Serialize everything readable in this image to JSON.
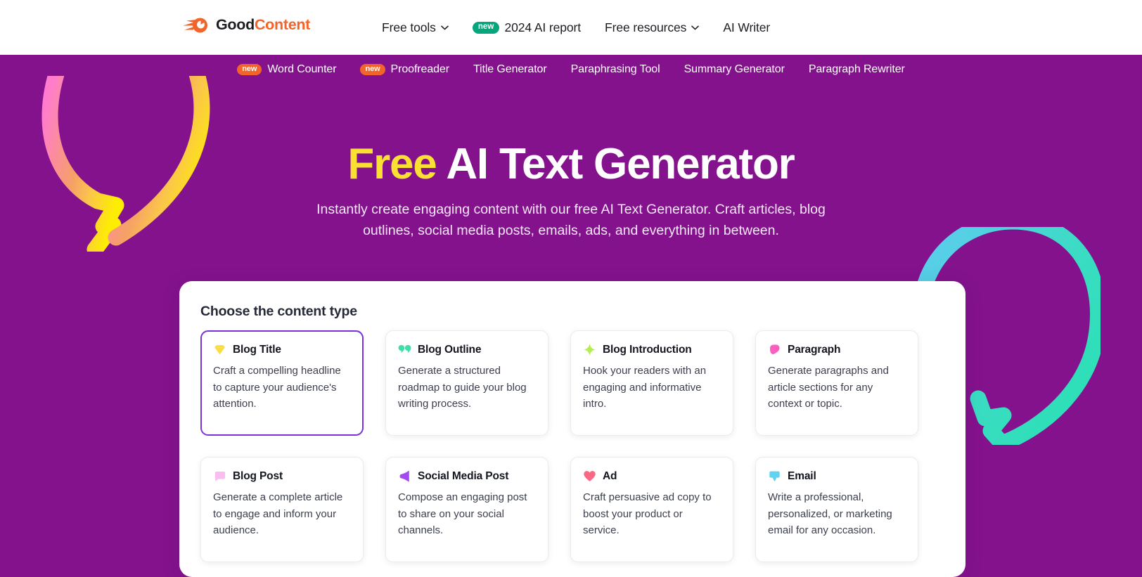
{
  "header": {
    "logo": {
      "icon": "comet-icon",
      "text_primary": "Good",
      "text_accent": "Content"
    },
    "nav": [
      {
        "label": "Free tools",
        "icon": "chevron-down-icon",
        "badge": null
      },
      {
        "label": "2024 AI report",
        "icon": null,
        "badge": "new"
      },
      {
        "label": "Free resources",
        "icon": "chevron-down-icon",
        "badge": null
      },
      {
        "label": "AI Writer",
        "icon": null,
        "badge": null
      }
    ]
  },
  "subnav": {
    "items": [
      {
        "label": "Word Counter",
        "badge": "new"
      },
      {
        "label": "Proofreader",
        "badge": "new"
      },
      {
        "label": "Title Generator",
        "badge": null
      },
      {
        "label": "Paraphrasing Tool",
        "badge": null
      },
      {
        "label": "Summary Generator",
        "badge": null
      },
      {
        "label": "Paragraph Rewriter",
        "badge": null
      }
    ]
  },
  "hero": {
    "title_highlight": "Free",
    "title_rest": " AI Text Generator",
    "subtitle": "Instantly create engaging content with our free AI Text Generator. Craft articles, blog outlines, social media posts, emails, ads, and everything in between."
  },
  "panel": {
    "title": "Choose the content type",
    "cards": [
      {
        "title": "Blog Title",
        "description": "Craft a compelling headline to capture your audience's attention.",
        "icon": "diamond-icon",
        "icon_color": "#fbdd3d",
        "selected": true
      },
      {
        "title": "Blog Outline",
        "description": "Generate a structured roadmap to guide your blog writing process.",
        "icon": "double-bubble-icon",
        "icon_color": "#3edfa6",
        "selected": false
      },
      {
        "title": "Blog Introduction",
        "description": "Hook your readers with an engaging and informative intro.",
        "icon": "sparkle-icon",
        "icon_color": "#b5ed55",
        "selected": false
      },
      {
        "title": "Paragraph",
        "description": "Generate paragraphs and article sections for any context or topic.",
        "icon": "pink-blob-icon",
        "icon_color": "#fd5fc0",
        "selected": false
      },
      {
        "title": "Blog Post",
        "description": "Generate a complete article to engage and inform your audience.",
        "icon": "chat-bubble-icon",
        "icon_color": "#f9bdf0",
        "selected": false
      },
      {
        "title": "Social Media Post",
        "description": "Compose an engaging post to share on your social channels.",
        "icon": "megaphone-icon",
        "icon_color": "#a24bf0",
        "selected": false
      },
      {
        "title": "Ad",
        "description": "Craft persuasive ad copy to boost your product or service.",
        "icon": "heart-icon",
        "icon_color": "#fb6883",
        "selected": false
      },
      {
        "title": "Email",
        "description": "Write a professional, personalized, or marketing email for any occasion.",
        "icon": "envelope-icon",
        "icon_color": "#5fd3ef",
        "selected": false
      }
    ]
  },
  "decor": {
    "left_bubble": {
      "name": "speech-bubble-gradient-left",
      "from": "#ff7ccd",
      "mid": "#f8a263",
      "to": "#fdee00"
    },
    "right_bubble": {
      "name": "speech-bubble-gradient-right",
      "from": "#5ecbf0",
      "to": "#2ae0b4"
    }
  },
  "colors": {
    "hero_background": "#84128d",
    "accent_orange": "#f3642a",
    "accent_green": "#06a67c",
    "highlight_yellow": "#fae033",
    "selected_border": "#7b32d6"
  }
}
